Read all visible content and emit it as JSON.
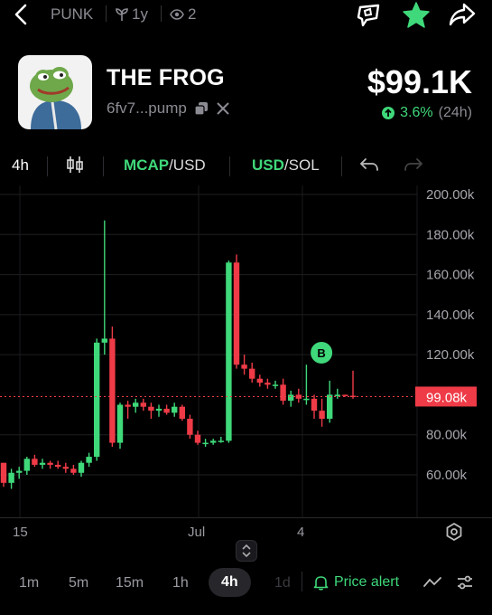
{
  "topbar": {
    "ticker": "PUNK",
    "age": "1y",
    "watchers": "2"
  },
  "token": {
    "name": "THE FROG",
    "address": "6fv7...pump",
    "price": "$99.1K",
    "change": "3.6%",
    "period": "(24h)"
  },
  "toolbar": {
    "interval": "4h",
    "mcap_label": "MCAP",
    "mcap_suffix": "/USD",
    "usd_label": "USD",
    "usd_suffix": "/SOL"
  },
  "chart_data": {
    "type": "candlestick",
    "yticks": [
      "200.00k",
      "180.00k",
      "160.00k",
      "140.00k",
      "120.00k",
      "80.00k",
      "60.00k"
    ],
    "ylim": [
      50000,
      205000
    ],
    "current_price_label": "99.08k",
    "current_price": 99080,
    "marker_label": "B",
    "xticks": [
      "15",
      "Jul",
      "4"
    ],
    "colors": {
      "up": "#3fd87a",
      "down": "#ee3b47"
    },
    "candles": [
      [
        66000,
        66000,
        54000,
        56000
      ],
      [
        56000,
        63000,
        53000,
        61000
      ],
      [
        61000,
        64000,
        58000,
        62000
      ],
      [
        62000,
        69000,
        60000,
        68000
      ],
      [
        68000,
        70000,
        64000,
        65000
      ],
      [
        65000,
        68000,
        63000,
        66000
      ],
      [
        66000,
        67000,
        63000,
        65000
      ],
      [
        65000,
        67000,
        63000,
        64000
      ],
      [
        64000,
        66000,
        61000,
        63000
      ],
      [
        63000,
        65000,
        60000,
        61000
      ],
      [
        61000,
        67000,
        59000,
        66000
      ],
      [
        66000,
        71000,
        64000,
        69000
      ],
      [
        69000,
        128000,
        67000,
        126000
      ],
      [
        126000,
        187000,
        120000,
        128000
      ],
      [
        128000,
        134000,
        74000,
        76000
      ],
      [
        76000,
        96000,
        73000,
        95000
      ],
      [
        95000,
        97000,
        88000,
        94000
      ],
      [
        94000,
        98000,
        91000,
        96000
      ],
      [
        96000,
        98000,
        92000,
        94000
      ],
      [
        94000,
        96000,
        88000,
        92000
      ],
      [
        92000,
        95000,
        89000,
        93000
      ],
      [
        93000,
        95000,
        90000,
        91000
      ],
      [
        91000,
        96000,
        89000,
        94000
      ],
      [
        94000,
        95000,
        87000,
        88000
      ],
      [
        88000,
        90000,
        78000,
        80000
      ],
      [
        80000,
        82000,
        75000,
        76000
      ],
      [
        76000,
        78000,
        74000,
        76000
      ],
      [
        76000,
        78000,
        75000,
        77000
      ],
      [
        77000,
        79000,
        76000,
        77000
      ],
      [
        77000,
        167000,
        76000,
        166000
      ],
      [
        166000,
        170000,
        113000,
        115000
      ],
      [
        115000,
        120000,
        110000,
        113000
      ],
      [
        113000,
        116000,
        106000,
        108000
      ],
      [
        108000,
        110000,
        104000,
        106000
      ],
      [
        106000,
        108000,
        103000,
        105000
      ],
      [
        105000,
        107000,
        103000,
        105000
      ],
      [
        105000,
        108000,
        95000,
        97000
      ],
      [
        97000,
        102000,
        94000,
        100000
      ],
      [
        100000,
        103000,
        96000,
        98000
      ],
      [
        98000,
        115000,
        95000,
        98000
      ],
      [
        98000,
        100000,
        88000,
        92000
      ],
      [
        92000,
        98000,
        84000,
        88000
      ],
      [
        88000,
        107000,
        86000,
        100000
      ],
      [
        100000,
        103000,
        98000,
        100000
      ],
      [
        100000,
        100000,
        99000,
        99500
      ],
      [
        99500,
        112000,
        98000,
        99080
      ]
    ]
  },
  "timeframes": [
    "1m",
    "5m",
    "15m",
    "1h",
    "4h",
    "1d"
  ],
  "active_timeframe": "4h",
  "price_alert_label": "Price alert"
}
